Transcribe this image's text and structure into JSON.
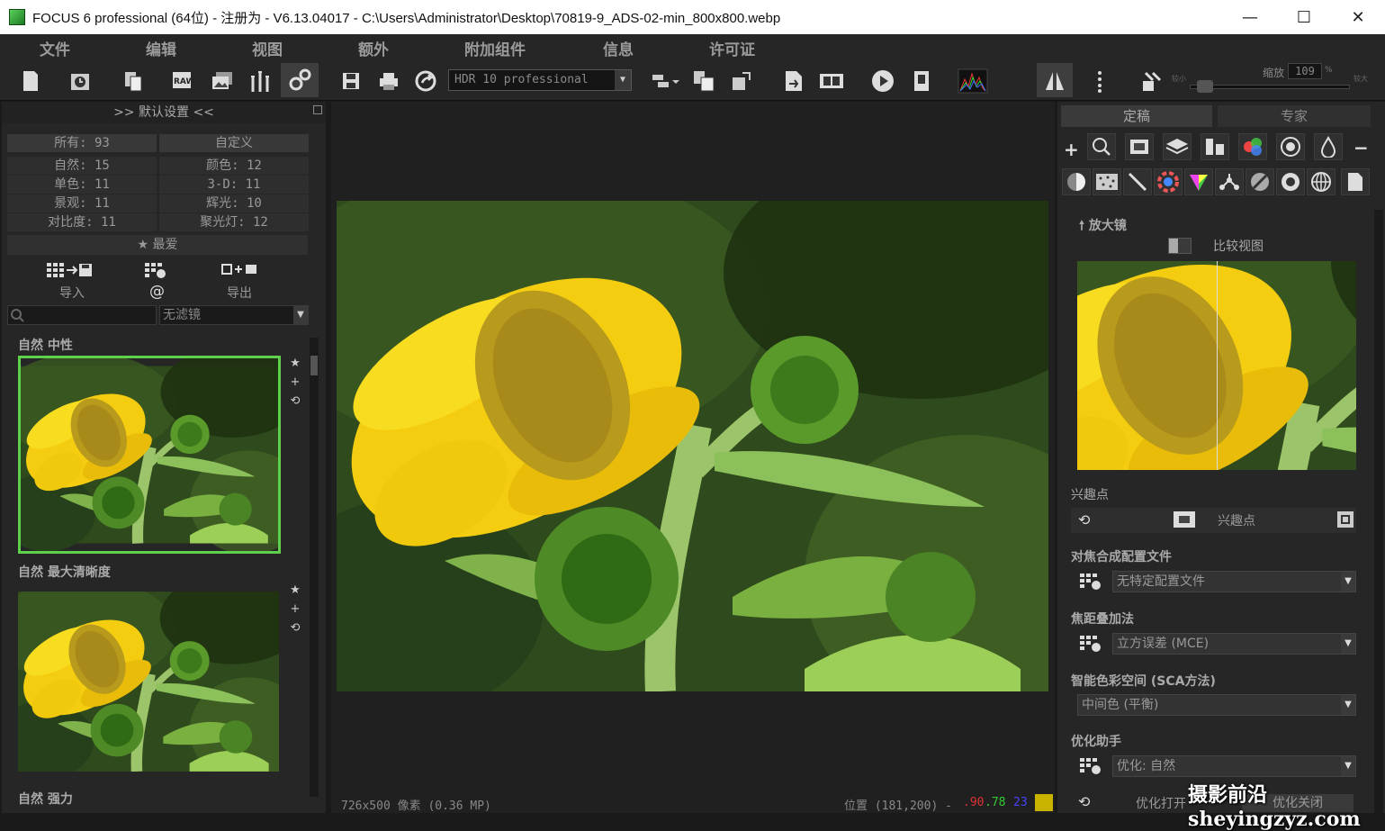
{
  "window": {
    "title": "FOCUS 6 professional (64位) - 注册为 - V6.13.04017 - C:\\Users\\Administrator\\Desktop\\70819-9_ADS-02-min_800x800.webp",
    "minimize": "—",
    "maximize": "☐",
    "close": "✕"
  },
  "menu": [
    "文件",
    "编辑",
    "视图",
    "额外",
    "附加组件",
    "信息",
    "许可证"
  ],
  "toolbar": {
    "preset_value": "HDR 10 professional",
    "zoom_label": "缩放",
    "zoom_value": "109",
    "zoom_unit": "%",
    "zoom_small": "较小",
    "zoom_large": "较大",
    "zoom_level": 0.05
  },
  "left": {
    "title": ">> 默认设置 <<",
    "categories": [
      {
        "label": "所有: 93",
        "col": 0
      },
      {
        "label": "自定义",
        "col": 1
      },
      {
        "label": "自然: 15",
        "col": 0
      },
      {
        "label": "颜色: 12",
        "col": 1
      },
      {
        "label": "单色: 11",
        "col": 0
      },
      {
        "label": "3-D: 11",
        "col": 1
      },
      {
        "label": "景观: 11",
        "col": 0
      },
      {
        "label": "辉光: 10",
        "col": 1
      },
      {
        "label": "对比度: 11",
        "col": 0
      },
      {
        "label": "聚光灯: 12",
        "col": 1
      }
    ],
    "favorites": "★ 最爱",
    "import": "导入",
    "at": "@",
    "export": "导出",
    "filter_value": "无滤镜",
    "presets": [
      {
        "title": "自然 中性"
      },
      {
        "title": "自然 最大清晰度"
      },
      {
        "title": "自然 强力"
      }
    ]
  },
  "status": {
    "size": "726x500 像素 (0.36 MP)",
    "position": "位置 (181,200) - ",
    "r": ".90",
    "g": ".78",
    "b": "23"
  },
  "right": {
    "tabs": [
      "定稿",
      "专家"
    ],
    "magnifier_title": "🠕 放大镜",
    "compare_view": "比较视图",
    "interest_title": "兴趣点",
    "interest_label": "兴趣点",
    "focus_profile_title": "对焦合成配置文件",
    "focus_profile_value": "无特定配置文件",
    "stack_method_title": "焦距叠加法",
    "stack_method_value": "立方误差 (MCE)",
    "color_space_title": "智能色彩空间 (SCA方法)",
    "color_space_value": "中间色 (平衡)",
    "optimize_title": "优化助手",
    "optimize_value": "优化: 自然",
    "optimize_open": "优化打开",
    "optimize_close": "优化关闭"
  },
  "watermark": "摄影前沿 sheyingzyz.com",
  "colors": {
    "selected_border": "#5ed04c",
    "swatch": "#c8b400"
  }
}
